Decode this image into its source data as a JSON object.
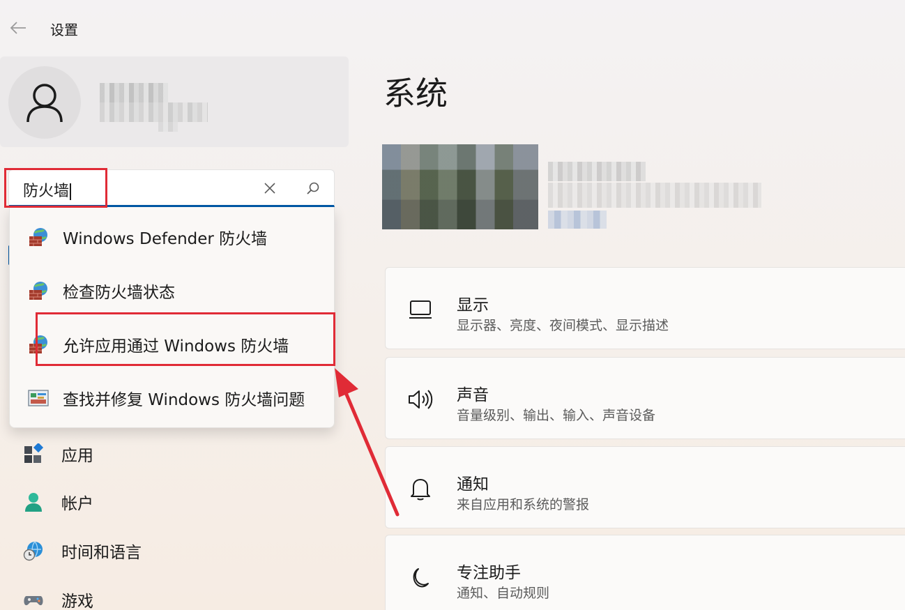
{
  "window": {
    "title": "设置"
  },
  "search": {
    "value": "防火墙",
    "suggestions": [
      {
        "label": "Windows Defender 防火墙",
        "icon": "firewall-globe-icon"
      },
      {
        "label": "检查防火墙状态",
        "icon": "firewall-globe-icon"
      },
      {
        "label": "允许应用通过 Windows 防火墙",
        "icon": "firewall-globe-icon"
      },
      {
        "label": "查找并修复 Windows 防火墙问题",
        "icon": "troubleshooter-icon"
      }
    ]
  },
  "sidebar": {
    "items": [
      {
        "label": "应用",
        "icon": "apps-icon"
      },
      {
        "label": "帐户",
        "icon": "account-icon"
      },
      {
        "label": "时间和语言",
        "icon": "time-language-icon"
      },
      {
        "label": "游戏",
        "icon": "gaming-icon"
      }
    ]
  },
  "main": {
    "title": "系统",
    "cards": [
      {
        "title": "显示",
        "subtitle": "显示器、亮度、夜间模式、显示描述",
        "icon": "monitor-icon"
      },
      {
        "title": "声音",
        "subtitle": "音量级别、输出、输入、声音设备",
        "icon": "speaker-icon"
      },
      {
        "title": "通知",
        "subtitle": "来自应用和系统的警报",
        "icon": "bell-icon"
      },
      {
        "title": "专注助手",
        "subtitle": "通知、自动规则",
        "icon": "moon-icon"
      }
    ]
  },
  "colors": {
    "accent": "#0058a6",
    "annotation": "#e02b36"
  }
}
